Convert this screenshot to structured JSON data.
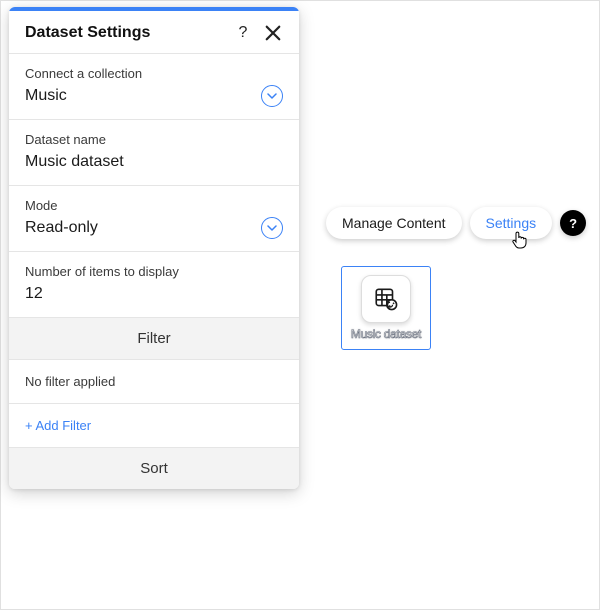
{
  "panel": {
    "title": "Dataset Settings",
    "collection": {
      "label": "Connect a collection",
      "value": "Music"
    },
    "name": {
      "label": "Dataset name",
      "value": "Music dataset"
    },
    "mode": {
      "label": "Mode",
      "value": "Read-only"
    },
    "items": {
      "label": "Number of items to display",
      "value": "12"
    },
    "filter": {
      "band": "Filter",
      "status": "No filter applied",
      "add": "+ Add Filter"
    },
    "sort": {
      "band": "Sort"
    }
  },
  "toolbar": {
    "manage": "Manage Content",
    "settings": "Settings",
    "help": "?"
  },
  "canvasCard": {
    "label": "Music dataset"
  }
}
